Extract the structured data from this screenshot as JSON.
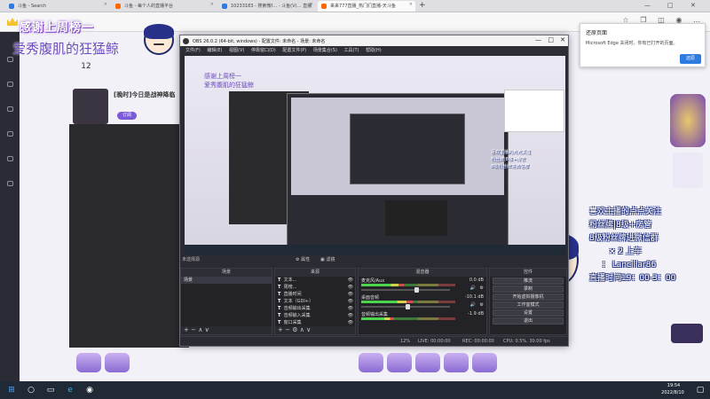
{
  "browser": {
    "tabs": [
      {
        "label": "斗鱼 - Search"
      },
      {
        "label": "斗鱼 - 每个人的直播平台"
      },
      {
        "label": "10233183 - 搜索微f… - 斗鱼(V)… 直播"
      },
      {
        "label": "来来777直播_热门们直播-天斗鱼"
      }
    ],
    "new_tab": "+",
    "window_controls": [
      "—",
      "□",
      "✕"
    ]
  },
  "douyu": {
    "follow_count": "12",
    "room_title": "[晚时]今日是战神降临",
    "follow_button": "订阅",
    "gift_labels": [
      "",
      "",
      "",
      "",
      "",
      "",
      "",
      "",
      ""
    ]
  },
  "overlay": {
    "banner_line1": "感谢上周榜一",
    "banner_line2": "爱秀腹肌的狂猛鲸",
    "texts": [
      "喜欢主播的点点关注",
      "粉丝牌|8级+房管",
      "8级粉丝牌进微信群",
      "× 2 上车",
      "： Lancillar86",
      "直播时间19：00-3：00"
    ]
  },
  "obs": {
    "title": "OBS 26.0.2 (64-bit, windows) - 配置文件: 未命名 - 场景: 未命名",
    "menu": [
      "文件(F)",
      "编辑(E)",
      "视图(V)",
      "停靠窗口(D)",
      "配置文件(P)",
      "场景集合(S)",
      "工具(T)",
      "帮助(H)"
    ],
    "no_source": "未选择源",
    "tab_properties": "属性",
    "tab_filters": "滤镜",
    "scenes_title": "场景",
    "scenes": [
      "场景"
    ],
    "sources_title": "来源",
    "sources": [
      {
        "icon": "T",
        "label": "文本..."
      },
      {
        "icon": "T",
        "label": "周榜..."
      },
      {
        "icon": "T",
        "label": "直播时间"
      },
      {
        "icon": "T",
        "label": "文本（GDI+）"
      },
      {
        "icon": "T",
        "label": "音频输出采集"
      },
      {
        "icon": "T",
        "label": "音频输入采集"
      },
      {
        "icon": "T",
        "label": "窗口采集"
      }
    ],
    "mixer_title": "混音器",
    "mixer": [
      {
        "label": "麦克风/Aux",
        "db": "0.0 dB"
      },
      {
        "label": "桌面音频",
        "db": "-10.1 dB"
      },
      {
        "label": "音频输出采集",
        "db": "-1.9 dB"
      }
    ],
    "controls_title": "控件",
    "controls": [
      "推流",
      "录制",
      "开始虚拟摄像机",
      "工作室模式",
      "设置",
      "退出"
    ],
    "status": {
      "live": "LIVE: 00:00:00",
      "rec": "REC: 00:00:00",
      "cpu": "CPU: 0.5%, 30.00 fps",
      "frames": "12%"
    }
  },
  "edge_popup": {
    "title": "还原页面",
    "body": "Microsoft Edge 关闭时，你有已打开的页面。",
    "button": "还原"
  },
  "taskbar": {
    "time": "19:54",
    "date": "2022/8/10"
  },
  "colors": {
    "accent": "#2d7be0",
    "obs_bg": "#2b2b33",
    "douyu_purple": "#7a3cc6"
  }
}
